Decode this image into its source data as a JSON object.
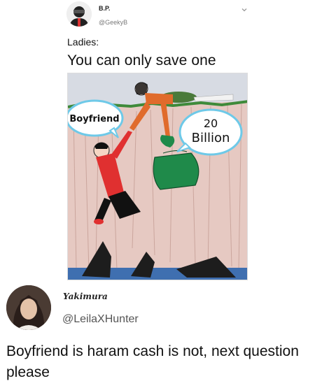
{
  "tweet": {
    "author_name": "B.P.",
    "author_handle": "@GeekyB",
    "intro": "Ladies:",
    "headline": "You can only save one",
    "meme": {
      "left_bubble": "Boyfriend",
      "right_bubble_line1": "20",
      "right_bubble_line2": "Billion"
    }
  },
  "reply": {
    "author_name": "Yakimura",
    "author_handle": "@LeilaXHunter",
    "text": "Boyfriend is haram cash is not, next question please"
  },
  "icons": {
    "more": "chevron-down-icon",
    "name_decoration": "crescent-moon-icon"
  },
  "colors": {
    "background": "#ffffff",
    "text": "#111111",
    "muted": "#555555",
    "moon": "#f4c430"
  }
}
